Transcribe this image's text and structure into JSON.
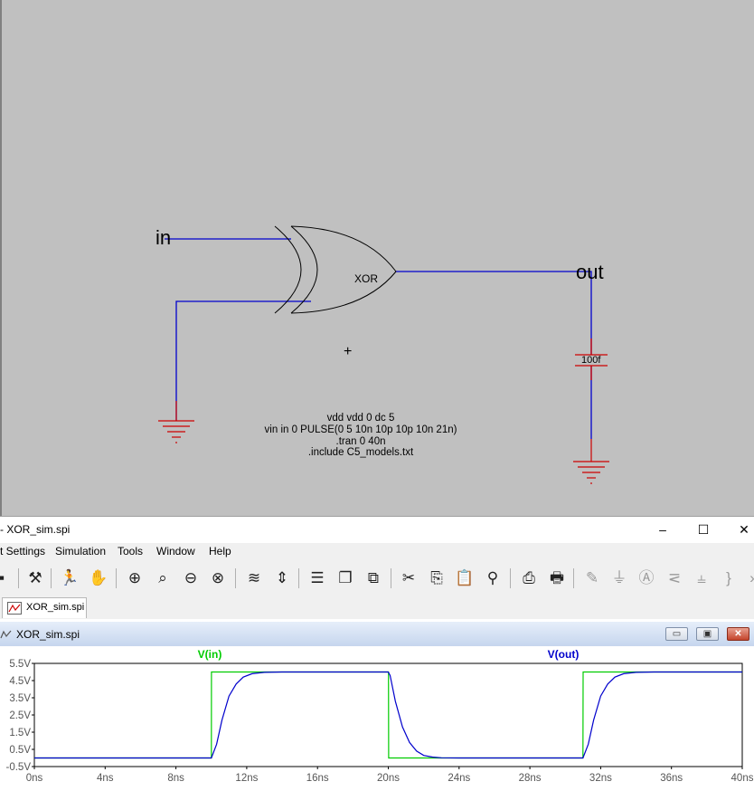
{
  "schematic": {
    "labels": {
      "in": "in",
      "out": "out",
      "gate": "XOR",
      "capacitor": "100f",
      "cursor": "+"
    },
    "netlist": [
      "vdd vdd 0 dc 5",
      "vin in 0 PULSE(0 5 10n 10p 10p 10n 21n)",
      ".tran 0 40n",
      ".include C5_models.txt"
    ],
    "colors": {
      "wire": "#0000cc",
      "component": "#cc0000",
      "background": "#c0c0c0"
    }
  },
  "window": {
    "title": "- XOR_sim.spi",
    "min": "–",
    "max": "☐",
    "close": "✕"
  },
  "menu": {
    "settings": "t Settings",
    "simulation": "Simulation",
    "tools": "Tools",
    "window": "Window",
    "help": "Help"
  },
  "toolbar": {
    "icons": [
      "save-icon",
      "hammer-icon",
      "run-icon",
      "pan-hand-icon",
      "zoom-in-icon",
      "zoom-fit-icon",
      "zoom-out-icon",
      "zoom-cancel-icon",
      "autorange-icon",
      "vertical-range-icon",
      "tile-horizontal-icon",
      "cascade-icon",
      "tile-vertical-icon",
      "cut-icon",
      "copy-icon",
      "paste-icon",
      "find-icon",
      "print-preview-icon",
      "print-icon",
      "pencil-icon",
      "ground-icon",
      "label-icon",
      "resistor-icon",
      "capacitor-icon",
      "inductor-icon"
    ]
  },
  "tab": {
    "label": "XOR_sim.spi"
  },
  "plot_window": {
    "title": "XOR_sim.spi",
    "min": "▭",
    "max": "▣",
    "close": "✕"
  },
  "chart_data": {
    "type": "line",
    "title": "",
    "xlabel": "",
    "ylabel": "",
    "xlim": [
      0,
      40
    ],
    "ylim": [
      -0.5,
      5.5
    ],
    "x_ticks": [
      "0ns",
      "4ns",
      "8ns",
      "12ns",
      "16ns",
      "20ns",
      "24ns",
      "28ns",
      "32ns",
      "36ns",
      "40ns"
    ],
    "y_ticks": [
      "5.5V",
      "4.5V",
      "3.5V",
      "2.5V",
      "1.5V",
      "0.5V",
      "-0.5V"
    ],
    "x_tick_values": [
      0,
      4,
      8,
      12,
      16,
      20,
      24,
      28,
      32,
      36,
      40
    ],
    "y_tick_values": [
      5.5,
      4.5,
      3.5,
      2.5,
      1.5,
      0.5,
      -0.5
    ],
    "series": [
      {
        "name": "V(in)",
        "color": "#00cc00",
        "x": [
          0,
          10,
          10.01,
          20.01,
          20.02,
          31,
          31.01,
          40
        ],
        "y": [
          0,
          0,
          5,
          5,
          0,
          0,
          5,
          5
        ]
      },
      {
        "name": "V(out)",
        "color": "#0000cc",
        "x": [
          0,
          10,
          10.3,
          10.6,
          11,
          11.4,
          11.8,
          12.3,
          13,
          14,
          20,
          20.1,
          20.4,
          20.8,
          21.2,
          21.6,
          22,
          22.5,
          23,
          24,
          31,
          31.3,
          31.6,
          32,
          32.4,
          32.8,
          33.3,
          34,
          35,
          40
        ],
        "y": [
          0,
          0,
          0.8,
          2.2,
          3.6,
          4.3,
          4.7,
          4.9,
          4.98,
          5,
          5,
          4.8,
          3.3,
          1.8,
          0.9,
          0.4,
          0.15,
          0.05,
          0.01,
          0,
          0,
          0.8,
          2.2,
          3.6,
          4.3,
          4.7,
          4.9,
          4.98,
          5,
          5
        ]
      }
    ]
  }
}
